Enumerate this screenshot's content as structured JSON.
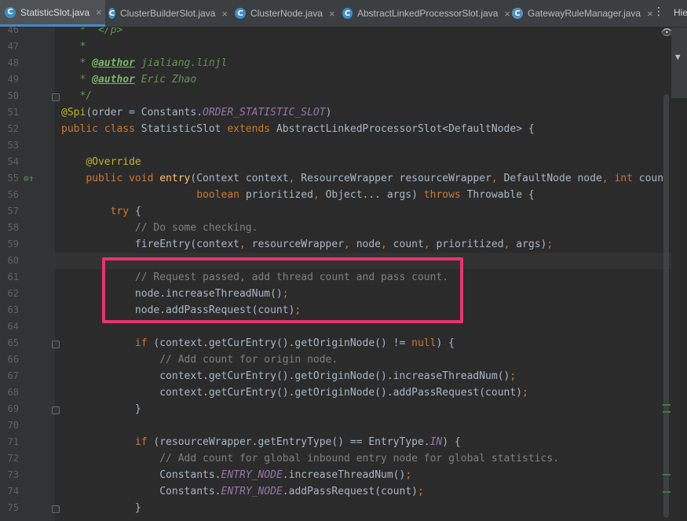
{
  "tabs": [
    {
      "label": "StatisticSlot.java",
      "active": true,
      "icon": "class-icon"
    },
    {
      "label": "ClusterBuilderSlot.java",
      "active": false,
      "icon": "class-icon"
    },
    {
      "label": "ClusterNode.java",
      "active": false,
      "icon": "class-icon"
    },
    {
      "label": "AbstractLinkedProcessorSlot.java",
      "active": false,
      "icon": "abstract-class-icon"
    },
    {
      "label": "GatewayRuleManager.java",
      "active": false,
      "icon": "class-icon"
    }
  ],
  "tab_close_glyph": "×",
  "tab_more_glyph": "⋮",
  "right_panel_title": "Hie",
  "line_numbers": [
    "46",
    "47",
    "48",
    "49",
    "50",
    "51",
    "52",
    "53",
    "54",
    "55",
    "56",
    "57",
    "58",
    "59",
    "60",
    "61",
    "62",
    "63",
    "64",
    "65",
    "66",
    "67",
    "68",
    "69",
    "70",
    "71",
    "72",
    "73",
    "74",
    "75"
  ],
  "code": {
    "l46_p": "</p>",
    "l48_tag": "@author",
    "l48_name": "jialiang.linjl",
    "l49_tag": "@author",
    "l49_name": "Eric Zhao",
    "l50": "*/",
    "l51_ann": "@Spi",
    "l51_a": "(order = Constants.",
    "l51_const": "ORDER_STATISTIC_SLOT",
    "l51_b": ")",
    "l52_kw1": "public class",
    "l52_a": "StatisticSlot",
    "l52_kw2": "extends",
    "l52_b": "AbstractLinkedProcessorSlot<DefaultNode> {",
    "l54_ann": "@Override",
    "l55_kw": "public void",
    "l55_fn": "entry",
    "l55_a": "(Context context",
    "l55_b": "ResourceWrapper resourceWrapper",
    "l55_c": "DefaultNode node",
    "l55_kw2": "int",
    "l55_d": "coun",
    "l56_kw": "boolean",
    "l56_a": "prioritized",
    "l56_b": "Object... args) ",
    "l56_kw2": "throws",
    "l56_c": "Throwable {",
    "l57_kw": "try",
    "l57_a": "{",
    "l58": "// Do some checking.",
    "l59_a": "fireEntry(context",
    "l59_b": "resourceWrapper",
    "l59_c": "node",
    "l59_d": "count",
    "l59_e": "prioritized",
    "l59_f": "args)",
    "l61": "// Request passed, add thread count and pass count.",
    "l62": "node.increaseThreadNum()",
    "l63": "node.addPassRequest(count)",
    "l65_kw": "if",
    "l65_a": "(context.getCurEntry().getOriginNode() != ",
    "l65_kw2": "null",
    "l65_b": ") {",
    "l66": "// Add count for origin node.",
    "l67": "context.getCurEntry().getOriginNode().increaseThreadNum()",
    "l68": "context.getCurEntry().getOriginNode().addPassRequest(count)",
    "l69": "}",
    "l71_kw": "if",
    "l71_a": "(resourceWrapper.getEntryType() == EntryType.",
    "l71_const": "IN",
    "l71_b": ") {",
    "l72": "// Add count for global inbound entry node for global statistics.",
    "l73_a": "Constants.",
    "l73_const": "ENTRY_NODE",
    "l73_b": ".increaseThreadNum()",
    "l74_a": "Constants.",
    "l74_const": "ENTRY_NODE",
    "l74_b": ".addPassRequest(count)",
    "l75": "}"
  },
  "colors": {
    "highlight_box": "#e8336f",
    "keyword": "#cc7832",
    "annotation": "#bbb529",
    "method": "#ffc66d",
    "constant": "#9876aa",
    "line_comment": "#808080",
    "doc_comment": "#629755"
  }
}
